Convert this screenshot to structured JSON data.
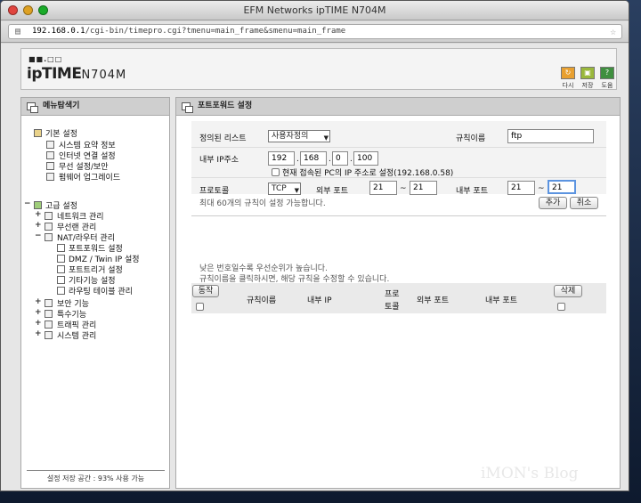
{
  "window": {
    "title": "EFM Networks ipTIME N704M",
    "url_host": "192.168.0.1",
    "url_path": "/cgi-bin/timepro.cgi?tmenu=main_frame&smenu=main_frame"
  },
  "header": {
    "logo_prefix": "ipTIME",
    "logo_model": "N704M",
    "logo_dots": "■■.□□",
    "buttons": [
      {
        "label": "다시",
        "icon": "refresh-icon",
        "color": "#e8a030"
      },
      {
        "label": "저장",
        "icon": "save-icon",
        "color": "#9ab83c"
      },
      {
        "label": "도움",
        "icon": "help-icon",
        "color": "#3f8f3f"
      }
    ]
  },
  "left": {
    "title": "메뉴탐색기",
    "basic": {
      "label": "기본 설정",
      "items": [
        "시스템 요약 정보",
        "인터넷 연결 설정",
        "무선 설정/보안",
        "펌웨어 업그레이드"
      ]
    },
    "advanced": {
      "label": "고급 설정",
      "groups": [
        "네트워크 관리",
        "무선랜 관리",
        "NAT/라우터 관리"
      ],
      "nat_items": [
        "포트포워드 설정",
        "DMZ / Twin IP 설정",
        "포트트리거 설정",
        "기타기능 설정",
        "라우팅 테이블 관리"
      ],
      "more": [
        "보안 기능",
        "특수기능",
        "트래픽 관리",
        "시스템 관리"
      ]
    },
    "footer": "설정 저장 공간 : 93% 사용 가능"
  },
  "right": {
    "title": "포트포워드 설정",
    "form": {
      "predef_label": "정의된 리스트",
      "predef_value": "사용자정의",
      "rulename_label": "규칙이름",
      "rulename_value": "ftp",
      "ip_label": "내부 IP주소",
      "ip": [
        "192",
        "168",
        "0",
        "100"
      ],
      "current_pc": "현재 접속된 PC의 IP 주소로 설정(192.168.0.58)",
      "protocol_label": "프로토콜",
      "protocol_value": "TCP",
      "ext_port_label": "외부 포트",
      "ext_from": "21",
      "ext_to": "21",
      "int_port_label": "내부 포트",
      "int_from": "21",
      "int_to": "21",
      "tilde": "~",
      "limit_note": "최대 60개의 규칙이 설정 가능합니다.",
      "add": "추가",
      "cancel": "취소"
    },
    "notes": [
      "낮은 번호일수록 우선순위가 높습니다.",
      "규칙이름을 클릭하시면, 해당 규칙을 수정할 수 있습니다."
    ],
    "table": {
      "action": "동작",
      "cols": [
        "규칙이름",
        "내부 IP",
        "프로",
        "토콜",
        "외부 포트",
        "내부 포트"
      ],
      "delete": "삭제"
    }
  },
  "watermark": "iMON's Blog"
}
